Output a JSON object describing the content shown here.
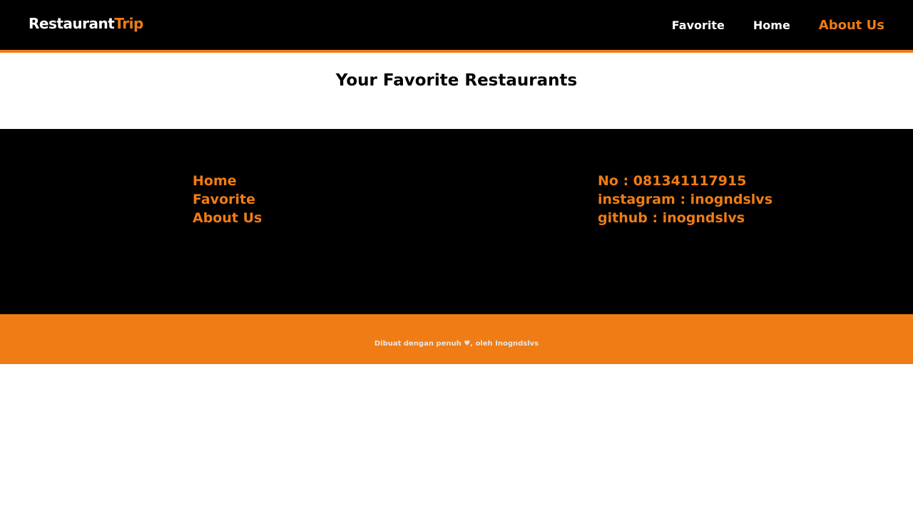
{
  "header": {
    "brand_part1": "Restaurant",
    "brand_part2": "Trip",
    "nav": [
      {
        "label": "Favorite"
      },
      {
        "label": "Home"
      },
      {
        "label": "About Us"
      }
    ]
  },
  "main": {
    "title": "Your Favorite Restaurants"
  },
  "footer": {
    "links": [
      {
        "label": "Home"
      },
      {
        "label": "Favorite"
      },
      {
        "label": "About Us"
      }
    ],
    "contacts": [
      {
        "label": "No : 081341117915"
      },
      {
        "label": "instagram : inogndslvs"
      },
      {
        "label": "github : inogndslvs"
      }
    ],
    "credit": "Dibuat dengan penuh ♥, oleh Inogndslvs"
  },
  "colors": {
    "accent": "#ef7c14",
    "navbar_bg": "#000000",
    "footer_bg": "#000000"
  }
}
